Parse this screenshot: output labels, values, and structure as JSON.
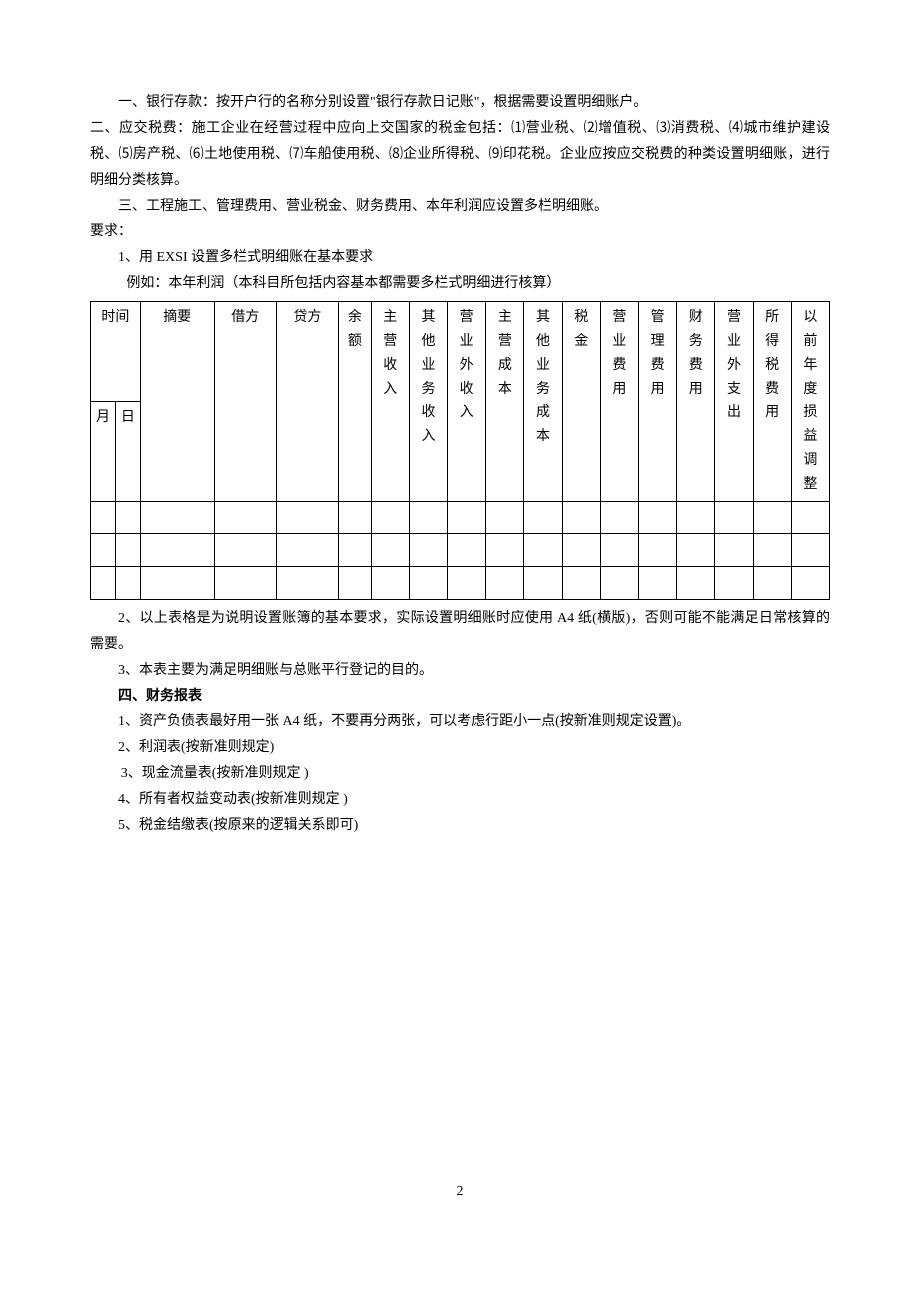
{
  "paragraphs": {
    "p1": "一、银行存款：按开户行的名称分别设置\"银行存款日记账\"，根据需要设置明细账户。",
    "p2": "二、应交税费：施工企业在经营过程中应向上交国家的税金包括：⑴营业税、⑵增值税、⑶消费税、⑷城市维护建设税、⑸房产税、⑹土地使用税、⑺车船使用税、⑻企业所得税、⑼印花税。企业应按应交税费的种类设置明细账，进行明细分类核算。",
    "p3": "三、工程施工、管理费用、营业税金、财务费用、本年利润应设置多栏明细账。",
    "req_label": "要求：",
    "req1": "1、用 EXSI 设置多栏式明细账在基本要求",
    "req1_example": "例如：本年利润（本科目所包括内容基本都需要多栏式明细进行核算）",
    "after2": "2、以上表格是为说明设置账簿的基本要求，实际设置明细账时应使用 A4 纸(横版)，否则可能不能满足日常核算的需要。",
    "after3": "3、本表主要为满足明细账与总账平行登记的目的。",
    "sec4_title": "四、财务报表",
    "s4_1": "1、资产负债表最好用一张 A4 纸，不要再分两张，可以考虑行距小一点(按新准则规定设置)。",
    "s4_2": "2、利润表(按新准则规定)",
    "s4_3": "3、现金流量表(按新准则规定 )",
    "s4_4": "4、所有者权益变动表(按新准则规定 )",
    "s4_5": "5、税金结缴表(按原来的逻辑关系即可)"
  },
  "table": {
    "header_row1": {
      "time": "时间",
      "summary": "摘要",
      "debit": "借方",
      "credit": "贷方",
      "balance": "余额",
      "cols": [
        "主营收入",
        "其他业务收入",
        "营业外收入",
        "主营成本",
        "其他业务成本",
        "税金",
        "营业费用",
        "管理费用",
        "财务费用",
        "营业外支出",
        "所得税费用",
        "以前年度损益调整"
      ]
    },
    "header_row2": {
      "month": "月",
      "day": "日"
    }
  },
  "page_number": "2"
}
